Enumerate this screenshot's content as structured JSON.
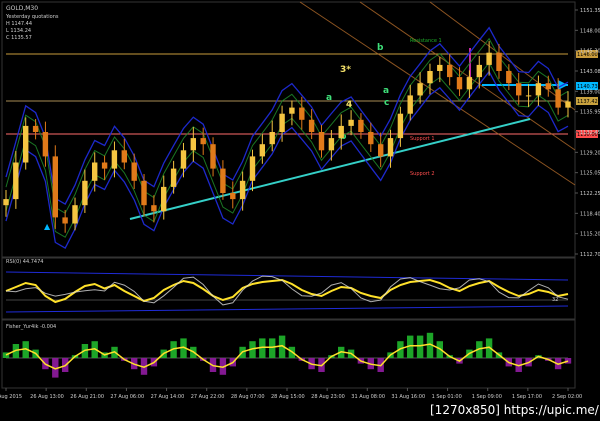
{
  "panel": {
    "symbol": "GOLD,M30",
    "info_lines": [
      "Yesterday quotations",
      "H 1147.44",
      "L 1134.24",
      "C 1135.57"
    ],
    "labels": {
      "resistance": "Resistance 1",
      "support1": "Support 1",
      "support2": "Support 2"
    },
    "wave_labels": [
      "3*",
      "a",
      "b",
      "c",
      "4",
      "b",
      "a"
    ],
    "flag": "▲",
    "price_badges": [
      "1146.00",
      "1140.73",
      "1137.42",
      "1130.00"
    ]
  },
  "rsi_panel": {
    "title": "RSI(0) 44.7474",
    "level_label": "32"
  },
  "fisher_panel": {
    "title": "Fisher_Yur4ik -0.004"
  },
  "colors": {
    "background": "#000000",
    "bull_candle": "#f5c542",
    "bear_candle": "#e07a1a",
    "band_blue": "#1f2bd6",
    "band_green": "#1f8a2a",
    "trendline": "#35d0c8",
    "resistance_line": "#c89b3c",
    "support_line": "#ff6b6b",
    "channel_orange": "#b06a2a",
    "arrow_cyan": "#00b7ff",
    "magenta_line": "#c32aa0",
    "rsi_line": "#ffe12a",
    "rsi_secondary": "#d9d9d9",
    "fisher_green": "#1fae2a",
    "fisher_purple": "#8a1a9a",
    "label_wave": "#3fe07a",
    "label_yellow": "#f5e26a"
  },
  "chart_data": {
    "type": "line",
    "title": "",
    "xlabel": "",
    "ylabel": "",
    "y_ticks": [
      "1151.35",
      "1148.00",
      "1145.30",
      "1143.08",
      "1139.00",
      "1135.95",
      "1132.45",
      "1129.20",
      "1125.05",
      "1122.25",
      "1118.40",
      "1115.20",
      "1112.70"
    ],
    "x_ticks": [
      "26 Aug 2015",
      "26 Aug 13:00",
      "26 Aug 21:00",
      "27 Aug 06:00",
      "27 Aug 14:00",
      "27 Aug 22:00",
      "28 Aug 07:00",
      "28 Aug 15:00",
      "28 Aug 23:00",
      "31 Aug 08:00",
      "31 Aug 16:00",
      "1 Sep 01:00",
      "1 Sep 09:00",
      "1 Sep 17:00",
      "2 Sep 02:00"
    ],
    "ylim": [
      1112,
      1152
    ],
    "series": [
      {
        "values": [
          1121,
          1127,
          1133,
          1132,
          1128,
          1118,
          1117,
          1120,
          1124,
          1127,
          1126,
          1129,
          1127,
          1124,
          1120,
          1119,
          1123,
          1126,
          1129,
          1131,
          1130,
          1126,
          1122,
          1121,
          1124,
          1128,
          1130,
          1132,
          1135,
          1136,
          1134,
          1132,
          1129,
          1131,
          1133,
          1134,
          1132,
          1130,
          1128,
          1131,
          1135,
          1138,
          1140,
          1142,
          1143,
          1141,
          1139,
          1141,
          1143,
          1145,
          1142,
          1140,
          1138,
          1138,
          1140,
          1139,
          1136,
          1137
        ]
      }
    ],
    "rsi": {
      "ylim": [
        0,
        100
      ],
      "level": 32,
      "values": [
        50,
        58,
        66,
        62,
        40,
        28,
        34,
        48,
        60,
        64,
        55,
        62,
        50,
        40,
        30,
        36,
        52,
        62,
        70,
        66,
        54,
        40,
        32,
        38,
        56,
        64,
        68,
        70,
        72,
        64,
        52,
        44,
        40,
        50,
        58,
        56,
        46,
        40,
        36,
        52,
        62,
        68,
        70,
        72,
        66,
        56,
        50,
        60,
        66,
        70,
        58,
        48,
        40,
        44,
        52,
        48,
        40,
        44
      ]
    },
    "fisher": {
      "ylim": [
        -1,
        1
      ],
      "values": [
        0.2,
        0.5,
        0.6,
        0.3,
        -0.4,
        -0.7,
        -0.5,
        0.1,
        0.5,
        0.6,
        0.2,
        0.4,
        -0.1,
        -0.4,
        -0.6,
        -0.3,
        0.3,
        0.6,
        0.7,
        0.4,
        -0.1,
        -0.5,
        -0.6,
        -0.3,
        0.4,
        0.6,
        0.7,
        0.7,
        0.8,
        0.4,
        -0.1,
        -0.4,
        -0.5,
        0.1,
        0.4,
        0.3,
        -0.2,
        -0.4,
        -0.5,
        0.2,
        0.6,
        0.8,
        0.8,
        0.9,
        0.6,
        0.1,
        -0.2,
        0.3,
        0.6,
        0.7,
        0.2,
        -0.3,
        -0.5,
        -0.3,
        0.1,
        -0.1,
        -0.4,
        -0.2
      ]
    }
  },
  "watermark": "[1270x850] https://upic.me/"
}
